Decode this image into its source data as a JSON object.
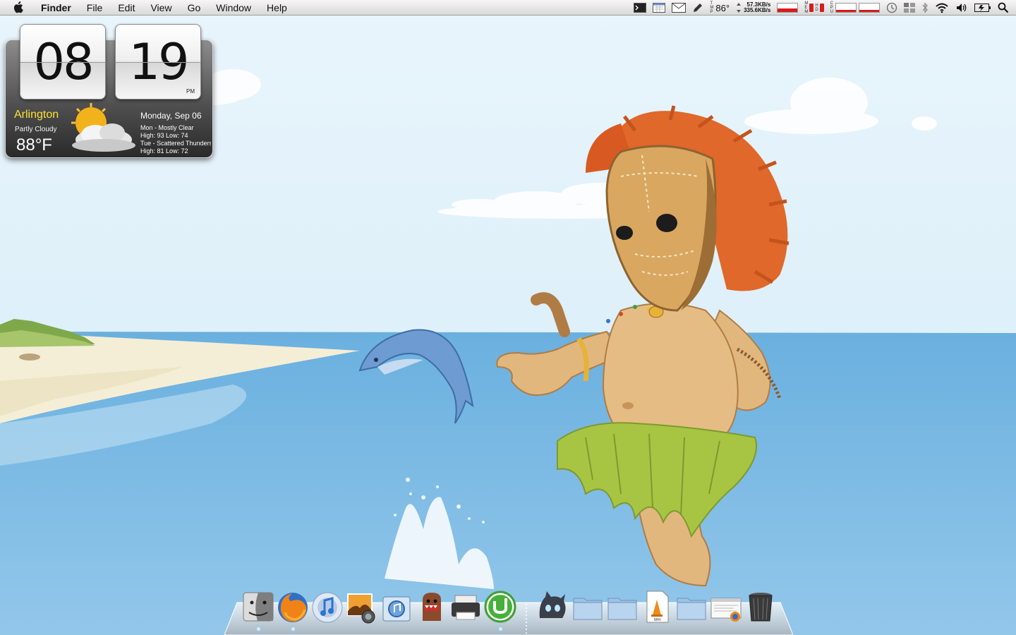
{
  "menubar": {
    "apple_icon": "apple-logo-icon",
    "app_name": "Finder",
    "menus": [
      "File",
      "Edit",
      "View",
      "Go",
      "Window",
      "Help"
    ],
    "status": {
      "temperature": "86°",
      "net_up": "57.3KB/s",
      "net_down": "335.6KB/s",
      "icons": [
        "terminal-icon",
        "calendar-icon",
        "mail-icon",
        "pencil-icon",
        "thermometer-icon",
        "network-speed-icon",
        "memory-meter-icon",
        "disk-meter-icon",
        "cpu-meter-icon",
        "time-machine-icon",
        "spaces-icon",
        "bluetooth-icon",
        "wifi-icon",
        "volume-icon",
        "battery-icon",
        "spotlight-search-icon"
      ]
    }
  },
  "widget": {
    "hour": "08",
    "minute": "19",
    "ampm": "PM",
    "city": "Arlington",
    "condition": "Partly Cloudy",
    "temperature": "88°F",
    "date": "Monday, Sep 06",
    "forecast": [
      {
        "line1": "Mon - Mostly Clear",
        "line2": "High: 93 Low: 74"
      },
      {
        "line1": "Tue - Scattered Thunderstorms",
        "line2": "High: 81 Low: 72"
      }
    ]
  },
  "dock": {
    "items": [
      {
        "name": "Finder",
        "icon": "finder-icon",
        "running": true
      },
      {
        "name": "Firefox",
        "icon": "firefox-icon",
        "running": true
      },
      {
        "name": "iTunes",
        "icon": "itunes-icon",
        "running": false
      },
      {
        "name": "iPhoto",
        "icon": "iphoto-icon",
        "running": false
      },
      {
        "name": "Preview",
        "icon": "preview-icon",
        "running": false
      },
      {
        "name": "Domo",
        "icon": "domo-icon",
        "running": false
      },
      {
        "name": "Printer",
        "icon": "printer-icon",
        "running": false
      },
      {
        "name": "uTorrent",
        "icon": "utorrent-icon",
        "running": true
      },
      {
        "name": "Adium",
        "icon": "adium-icon",
        "running": false
      },
      {
        "name": "Applications",
        "icon": "folder-icon",
        "running": false
      },
      {
        "name": "Documents",
        "icon": "folder-icon",
        "running": false
      },
      {
        "name": "M4V Movie",
        "icon": "vlc-m4v-file-icon",
        "running": false
      },
      {
        "name": "Downloads",
        "icon": "folder-icon",
        "running": false
      },
      {
        "name": "Web Page",
        "icon": "webpage-file-icon",
        "running": false
      },
      {
        "name": "Trash",
        "icon": "trash-icon",
        "running": false
      }
    ]
  },
  "colors": {
    "sky": "#dbeef8",
    "sea": "#7fb8e2",
    "sand": "#f3ecd2",
    "hair": "#e0682a",
    "skin": "#e2b77e",
    "skirt": "#a8c443",
    "city_text": "#ffe033"
  }
}
